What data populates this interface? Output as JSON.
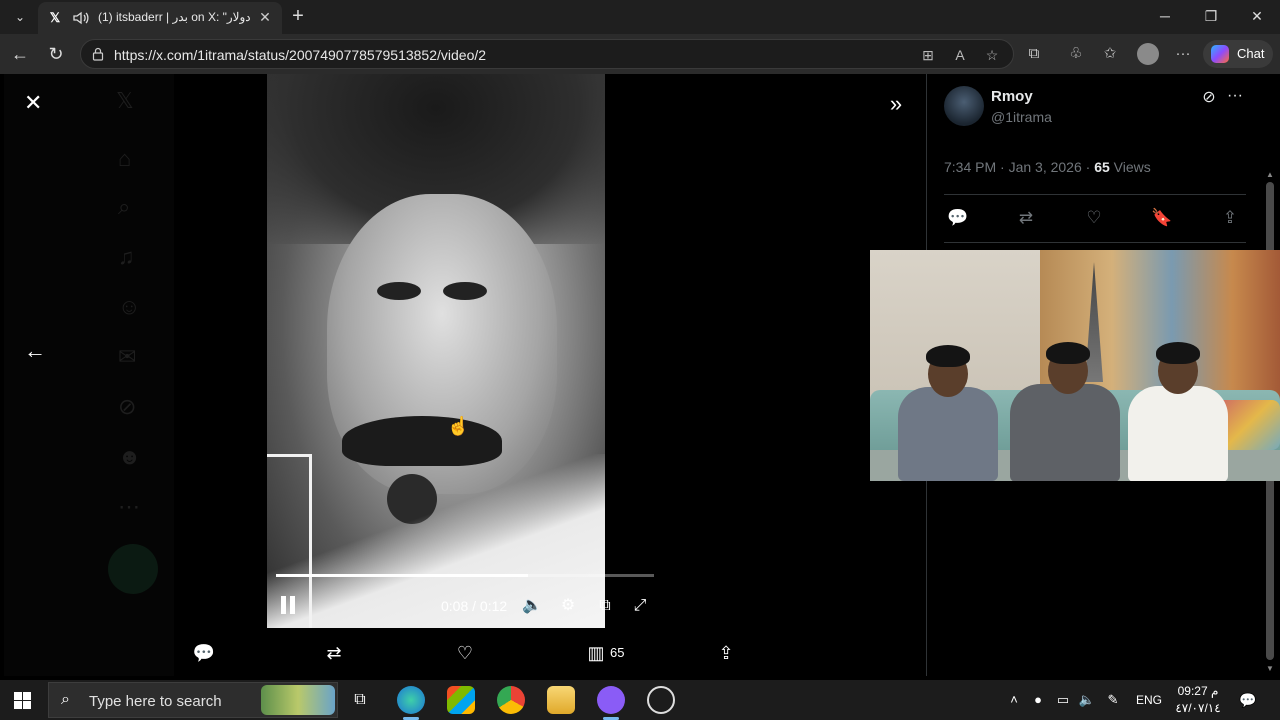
{
  "browser": {
    "tab": {
      "title": "(1) itsbaderr | بدر on X: \"دولار",
      "favicon": "x-logo-icon",
      "audio_icon": "speaker-icon"
    },
    "url": "https://x.com/1itrama/status/2007490778579513852/video/2",
    "chat_label": "Chat"
  },
  "viewer": {
    "time": "0:08 / 0:12",
    "progress_fraction": 0.667,
    "views_count": "65"
  },
  "post": {
    "author_name": "Rmoy",
    "author_handle": "@1itrama",
    "time": "7:34 PM · Jan 3, 2026 · ",
    "views": "65",
    "views_label": " Views"
  },
  "taskbar": {
    "search_placeholder": "Type here to search",
    "language": "ENG",
    "time": "09:27 م",
    "date": "٤٧/٠٧/١٤"
  },
  "colors": {
    "accent": "#1d9bf0",
    "muted_text": "#71767b",
    "primary_text": "#e7e9ea"
  }
}
